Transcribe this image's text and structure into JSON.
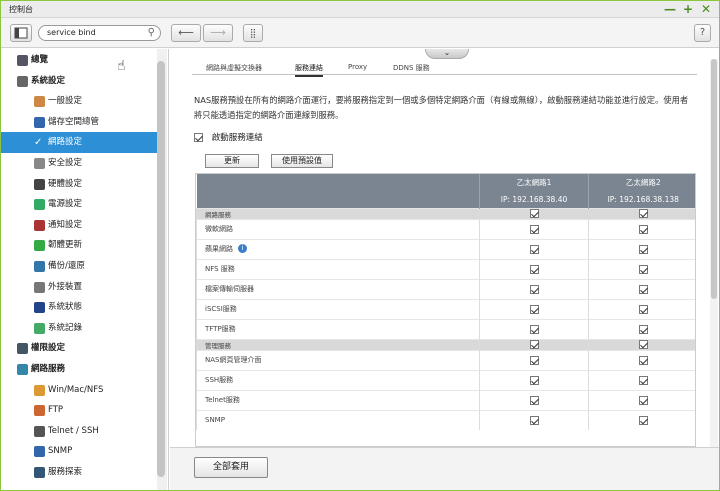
{
  "window": {
    "title": "控制台",
    "minimize": "—",
    "maximize": "+",
    "close": "✕"
  },
  "toolbar": {
    "search_value": "service bind",
    "help": "?"
  },
  "sidebar": {
    "items": [
      {
        "label": "總覽",
        "level": "cat",
        "icon": "overview-icon",
        "color": "#556"
      },
      {
        "label": "系統設定",
        "level": "cat",
        "icon": "gear-icon",
        "color": "#666"
      },
      {
        "label": "一般設定",
        "level": "sub",
        "icon": "general-settings-icon",
        "color": "#c84"
      },
      {
        "label": "儲存空間總管",
        "level": "sub",
        "icon": "storage-icon",
        "color": "#36a"
      },
      {
        "label": "網路設定",
        "level": "sub",
        "icon": "network-icon",
        "color": "#fff",
        "selected": true
      },
      {
        "label": "安全設定",
        "level": "sub",
        "icon": "lock-icon",
        "color": "#888"
      },
      {
        "label": "硬體設定",
        "level": "sub",
        "icon": "hardware-icon",
        "color": "#444"
      },
      {
        "label": "電源設定",
        "level": "sub",
        "icon": "power-icon",
        "color": "#3a6"
      },
      {
        "label": "通知設定",
        "level": "sub",
        "icon": "notification-icon",
        "color": "#a33"
      },
      {
        "label": "韌體更新",
        "level": "sub",
        "icon": "firmware-icon",
        "color": "#3a4"
      },
      {
        "label": "備份/還原",
        "level": "sub",
        "icon": "backup-icon",
        "color": "#37a"
      },
      {
        "label": "外接裝置",
        "level": "sub",
        "icon": "external-device-icon",
        "color": "#777"
      },
      {
        "label": "系統狀態",
        "level": "sub",
        "icon": "system-status-icon",
        "color": "#248"
      },
      {
        "label": "系統記錄",
        "level": "sub",
        "icon": "system-log-icon",
        "color": "#4a6"
      },
      {
        "label": "權限設定",
        "level": "cat",
        "icon": "user-icon",
        "color": "#456"
      },
      {
        "label": "網路服務",
        "level": "cat",
        "icon": "network-services-icon",
        "color": "#38a"
      },
      {
        "label": "Win/Mac/NFS",
        "level": "sub",
        "icon": "win-mac-nfs-icon",
        "color": "#d93"
      },
      {
        "label": "FTP",
        "level": "sub",
        "icon": "ftp-icon",
        "color": "#c63"
      },
      {
        "label": "Telnet / SSH",
        "level": "sub",
        "icon": "terminal-icon",
        "color": "#555"
      },
      {
        "label": "SNMP",
        "level": "sub",
        "icon": "snmp-icon",
        "color": "#36a"
      },
      {
        "label": "服務探索",
        "level": "sub",
        "icon": "service-discovery-icon",
        "color": "#357"
      }
    ]
  },
  "tabs": [
    {
      "label": "網路與虛擬交換器",
      "active": false
    },
    {
      "label": "服務連結",
      "active": true
    },
    {
      "label": "Proxy",
      "active": false
    },
    {
      "label": "DDNS 服務",
      "active": false
    }
  ],
  "description": "NAS服務預設在所有的網路介面運行，要將服務指定到一個或多個特定網路介面（有線或無線），啟動服務連結功能並進行設定。使用者將只能透過指定的網路介面連線到服務。",
  "enable_label": "啟動服務連結",
  "buttons": {
    "refresh": "更新",
    "use_default": "使用預設值",
    "apply_all": "全部套用"
  },
  "table": {
    "columns": [
      {
        "name": "乙太網路1",
        "ip": "IP: 192.168.38.40"
      },
      {
        "name": "乙太網路2",
        "ip": "IP: 192.168.38.138"
      }
    ],
    "rows": [
      {
        "type": "group",
        "label": "網路服務"
      },
      {
        "type": "row",
        "label": "微軟網路",
        "checks": [
          true,
          true
        ]
      },
      {
        "type": "row",
        "label": "蘋果網路",
        "checks": [
          true,
          true
        ],
        "info": true
      },
      {
        "type": "row",
        "label": "NFS 服務",
        "checks": [
          true,
          true
        ]
      },
      {
        "type": "row",
        "label": "檔案傳輸伺服器",
        "checks": [
          true,
          true
        ]
      },
      {
        "type": "row",
        "label": "iSCSI服務",
        "checks": [
          true,
          true
        ]
      },
      {
        "type": "row",
        "label": "TFTP服務",
        "checks": [
          true,
          true
        ]
      },
      {
        "type": "group",
        "label": "管理服務"
      },
      {
        "type": "row",
        "label": "NAS網頁管理介面",
        "checks": [
          true,
          true
        ]
      },
      {
        "type": "row",
        "label": "SSH服務",
        "checks": [
          true,
          true
        ]
      },
      {
        "type": "row",
        "label": "Telnet服務",
        "checks": [
          true,
          true
        ]
      },
      {
        "type": "row",
        "label": "SNMP",
        "checks": [
          true,
          true
        ]
      }
    ]
  }
}
